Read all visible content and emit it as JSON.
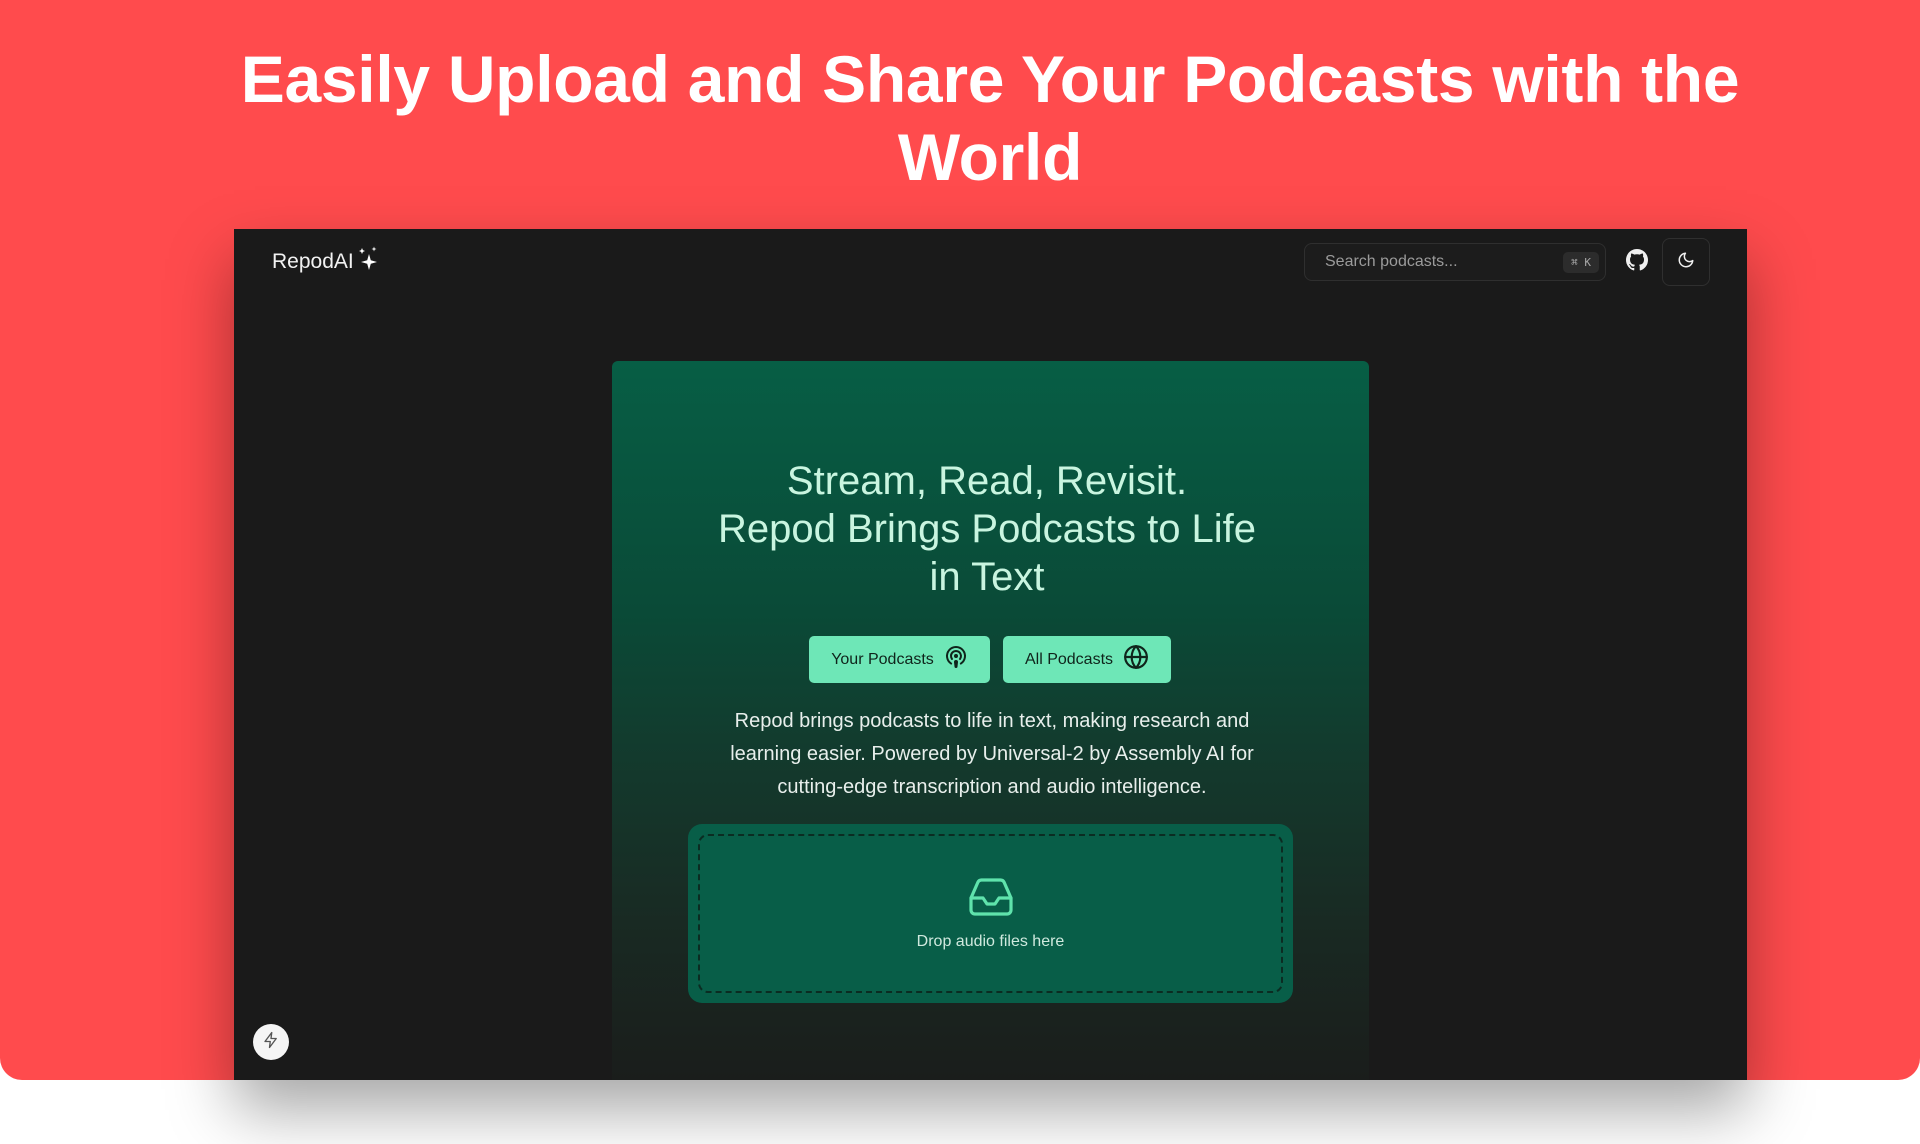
{
  "headline": "Easily Upload and Share Your Podcasts with the World",
  "app": {
    "brand": "RepodAI",
    "search": {
      "placeholder": "Search podcasts...",
      "shortcut": "⌘ K"
    }
  },
  "hero": {
    "title_lines": [
      "Stream, Read, Revisit.",
      "Repod Brings Podcasts to Life",
      "in Text"
    ],
    "buttons": {
      "your_podcasts": "Your Podcasts",
      "all_podcasts": "All Podcasts"
    },
    "description": "Repod brings podcasts to life in text, making research and learning easier. Powered by Universal-2 by Assembly AI for cutting-edge transcription and audio intelligence.",
    "dropzone": {
      "label": "Drop audio files here"
    }
  },
  "icons": {
    "sparkle": "sparkles-icon",
    "github": "github-icon",
    "theme": "moon-icon",
    "your_podcasts": "podcast-icon",
    "all_podcasts": "globe-icon",
    "dropzone": "inbox-icon",
    "corner": "lightning-icon"
  },
  "colors": {
    "banner": "#ff4b4d",
    "window_bg": "#1a1a1a",
    "hero_top": "#075e45",
    "pill_bg": "#6ee7b7",
    "title_text": "#c9f5e0",
    "dropzone_bg": "#085e48"
  }
}
